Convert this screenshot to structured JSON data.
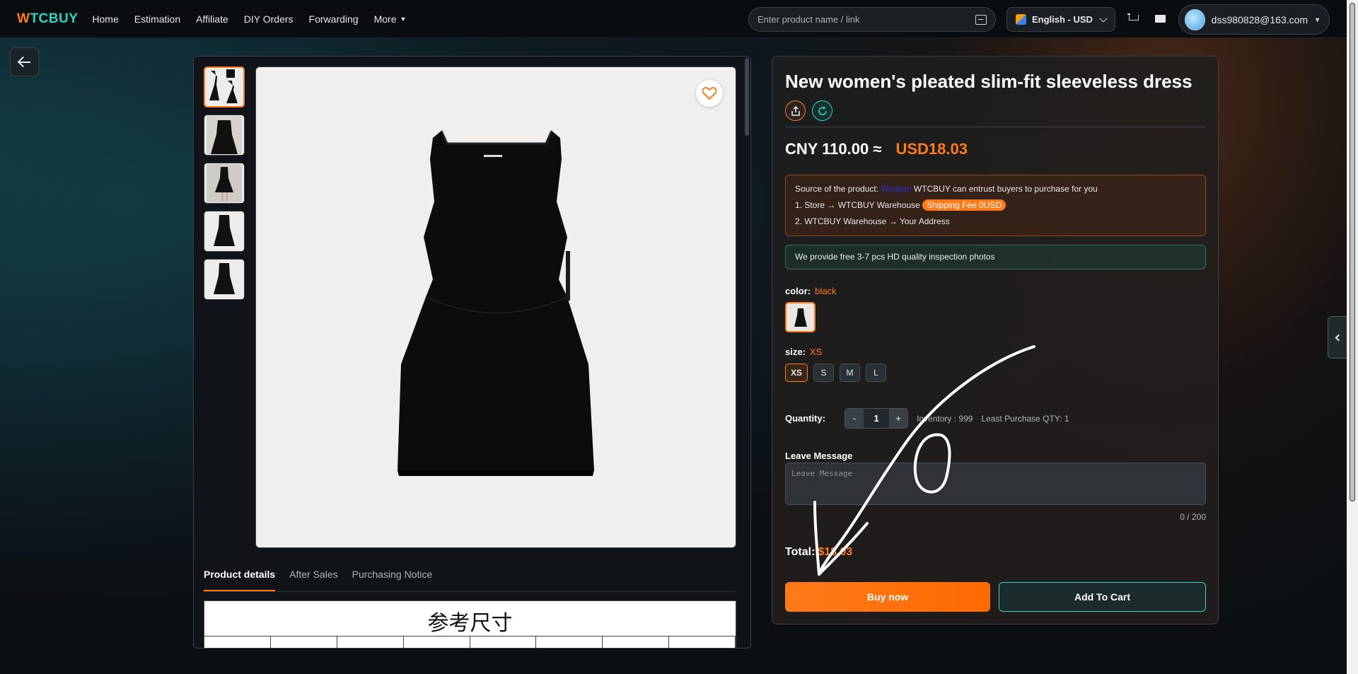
{
  "nav": {
    "logo_w": "W",
    "logo_rest": "TCBUY",
    "links": [
      "Home",
      "Estimation",
      "Affiliate",
      "DIY Orders",
      "Forwarding"
    ],
    "more": "More",
    "search_placeholder": "Enter product name / link",
    "language": "English - USD",
    "user_email": "dss980828@163.com"
  },
  "product": {
    "title": "New women's pleated slim-fit sleeveless dress",
    "price_cny": "CNY 110.00 ≈",
    "price_usd": "USD18.03",
    "source_prefix": "Source of the product:",
    "source_name": "Weidian",
    "source_suffix": "WTCBUY can entrust buyers to purchase for you",
    "step1": "1. Store → WTCBUY Warehouse",
    "step1_badge": "Shipping Fee 0USD",
    "step2": "2. WTCBUY Warehouse → Your Address",
    "inspection": "We provide free 3-7 pcs HD quality inspection photos",
    "color_label": "color:",
    "color_value": "black",
    "size_label": "size:",
    "size_value": "XS",
    "sizes": [
      "XS",
      "S",
      "M",
      "L"
    ],
    "quantity_label": "Quantity:",
    "qty_minus": "-",
    "quantity": "1",
    "qty_plus": "+",
    "inventory": "Inventory : 999",
    "least_qty": "Least Purchase QTY: 1",
    "message_label": "Leave Message",
    "message_placeholder": "Leave Message",
    "message_counter": "0 / 200",
    "total_label": "Total:",
    "total_value": "$18.03",
    "buy_now": "Buy now",
    "add_to_cart": "Add To Cart"
  },
  "details": {
    "tabs": [
      "Product details",
      "After Sales",
      "Purchasing Notice"
    ],
    "size_chart_title": "参考尺寸"
  },
  "colors": {
    "accent_orange": "#ff7a1a",
    "accent_teal": "#2dd4bf"
  }
}
